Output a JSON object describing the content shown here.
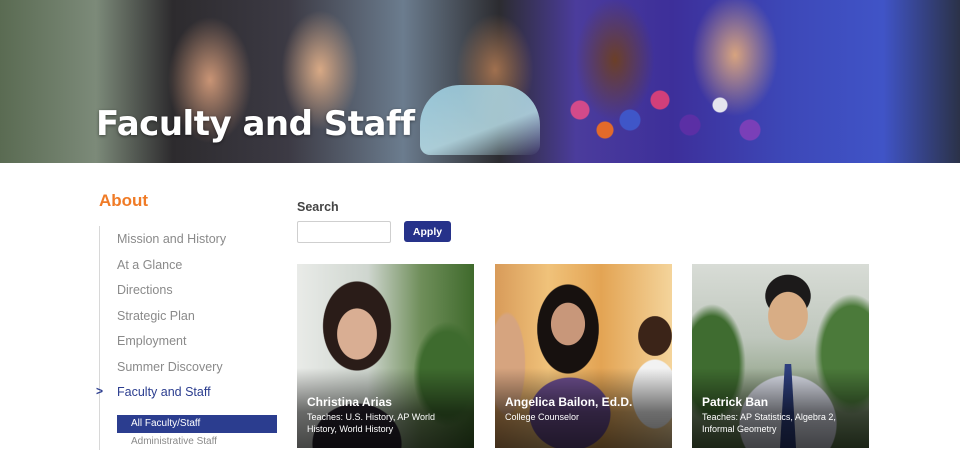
{
  "hero": {
    "title": "Faculty and Staff"
  },
  "sidebar": {
    "heading": "About",
    "items": [
      {
        "label": "Mission and History",
        "active": false
      },
      {
        "label": "At a Glance",
        "active": false
      },
      {
        "label": "Directions",
        "active": false
      },
      {
        "label": "Strategic Plan",
        "active": false
      },
      {
        "label": "Employment",
        "active": false
      },
      {
        "label": "Summer Discovery",
        "active": false
      },
      {
        "label": "Faculty and Staff",
        "active": true
      }
    ],
    "active_marker": ">",
    "subitems": [
      {
        "label": "All Faculty/Staff",
        "active": true
      },
      {
        "label": "Administrative Staff",
        "active": false
      }
    ]
  },
  "search": {
    "label": "Search",
    "value": "",
    "placeholder": "",
    "apply_label": "Apply"
  },
  "cards": [
    {
      "name": "Christina Arias",
      "description": "Teaches: U.S. History, AP World History, World History"
    },
    {
      "name": "Angelica Bailon, Ed.D.",
      "description": "College Counselor"
    },
    {
      "name": "Patrick Ban",
      "description": "Teaches: AP Statistics, Algebra 2, Informal Geometry"
    }
  ],
  "colors": {
    "accent_orange": "#f07b26",
    "brand_navy": "#26328a",
    "nav_gray": "#8a8a8a"
  }
}
